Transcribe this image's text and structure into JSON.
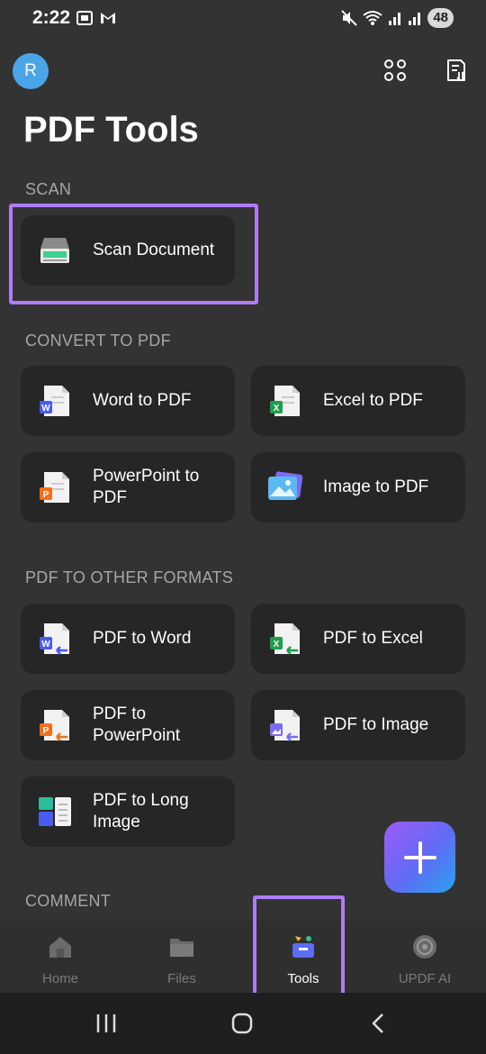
{
  "status_bar": {
    "time": "2:22",
    "battery": "48"
  },
  "header": {
    "avatar_initial": "R",
    "title": "PDF Tools"
  },
  "sections": {
    "scan": {
      "label": "SCAN",
      "items": [
        {
          "label": "Scan Document",
          "icon": "scanner-icon"
        }
      ]
    },
    "convert_to_pdf": {
      "label": "CONVERT TO PDF",
      "items": [
        {
          "label": "Word to PDF",
          "icon": "word-file-icon"
        },
        {
          "label": "Excel to PDF",
          "icon": "excel-file-icon"
        },
        {
          "label": "PowerPoint to PDF",
          "icon": "powerpoint-file-icon"
        },
        {
          "label": "Image to PDF",
          "icon": "image-file-icon"
        }
      ]
    },
    "pdf_to_other": {
      "label": "PDF TO OTHER FORMATS",
      "items": [
        {
          "label": "PDF to Word",
          "icon": "pdf-to-word-icon"
        },
        {
          "label": "PDF to Excel",
          "icon": "pdf-to-excel-icon"
        },
        {
          "label": "PDF to PowerPoint",
          "icon": "pdf-to-powerpoint-icon"
        },
        {
          "label": "PDF to Image",
          "icon": "pdf-to-image-icon"
        },
        {
          "label": "PDF to Long Image",
          "icon": "pdf-to-long-image-icon"
        }
      ]
    },
    "comment": {
      "label": "COMMENT"
    }
  },
  "bottom_nav": {
    "items": [
      {
        "label": "Home",
        "icon": "home-icon",
        "active": false
      },
      {
        "label": "Files",
        "icon": "folder-icon",
        "active": false
      },
      {
        "label": "Tools",
        "icon": "toolbox-icon",
        "active": true
      },
      {
        "label": "UPDF AI",
        "icon": "ai-icon",
        "active": false
      }
    ]
  },
  "colors": {
    "background": "#333333",
    "card": "#262626",
    "section_label": "#a6a6a6",
    "highlight": "#b07cf5",
    "word_blue": "#4a5cf0",
    "excel_green": "#1e9e4a",
    "powerpoint_orange": "#f0701e"
  }
}
